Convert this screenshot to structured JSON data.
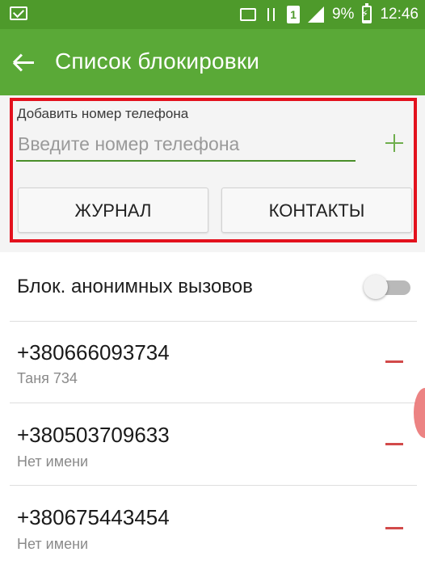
{
  "status_bar": {
    "battery_percent": "9%",
    "time": "12:46",
    "sim_slot": "1",
    "icons": [
      "notification-icon",
      "cast-icon",
      "data-transfer-icon",
      "sim-icon",
      "signal-icon",
      "battery-charging-icon"
    ]
  },
  "app_bar": {
    "title": "Список блокировки",
    "back_icon": "back-arrow-icon",
    "color": "#5aa937"
  },
  "add_number": {
    "label": "Добавить номер телефона",
    "placeholder": "Введите номер телефона",
    "value": "",
    "add_icon": "plus-icon",
    "journal_button": "ЖУРНАЛ",
    "contacts_button": "КОНТАКТЫ",
    "highlight_color": "#e3111d"
  },
  "anonymous_block": {
    "label": "Блок. анонимных вызовов",
    "enabled": false
  },
  "blocked_numbers": [
    {
      "number": "+380666093734",
      "name": "Таня 734"
    },
    {
      "number": "+380503709633",
      "name": "Нет имени"
    },
    {
      "number": "+380675443454",
      "name": "Нет имени"
    }
  ],
  "remove_icon": "minus-icon",
  "remove_color": "#d24a4a"
}
